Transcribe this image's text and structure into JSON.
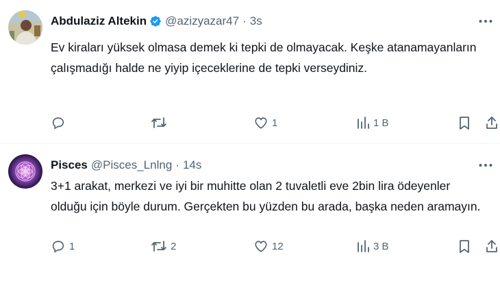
{
  "tweets": [
    {
      "author_name": "Abdulaziz Altekin",
      "verified": true,
      "handle": "@azizyazar47",
      "separator": "·",
      "time": "3s",
      "text": "Ev kiraları yüksek olmasa demek ki tepki de olmayacak. Keşke atanamayanların çalışmadığı halde ne yiyip içeceklerine de tepki verseydiniz.",
      "replies": "",
      "retweets": "",
      "likes": "1",
      "views": "1 B"
    },
    {
      "author_name": "Pisces",
      "verified": false,
      "handle": "@Pisces_Lnlng",
      "separator": "·",
      "time": "14s",
      "text": "3+1 arakat, merkezi ve iyi bir muhitte olan 2 tuvaletli eve 2bin lira ödeyenler olduğu için böyle durum. Gerçekten bu yüzden bu arada, başka neden aramayın.",
      "replies": "1",
      "retweets": "2",
      "likes": "12",
      "views": "3 B"
    }
  ],
  "icons": {
    "verified": "verified-badge-icon",
    "more": "more-dots-icon",
    "reply": "reply-icon",
    "retweet": "retweet-icon",
    "like": "heart-icon",
    "views": "views-chart-icon",
    "bookmark": "bookmark-icon",
    "share": "share-icon"
  },
  "colors": {
    "text": "#0f1419",
    "secondary": "#536471",
    "verified": "#1d9bf0",
    "divider": "#eff3f4"
  }
}
